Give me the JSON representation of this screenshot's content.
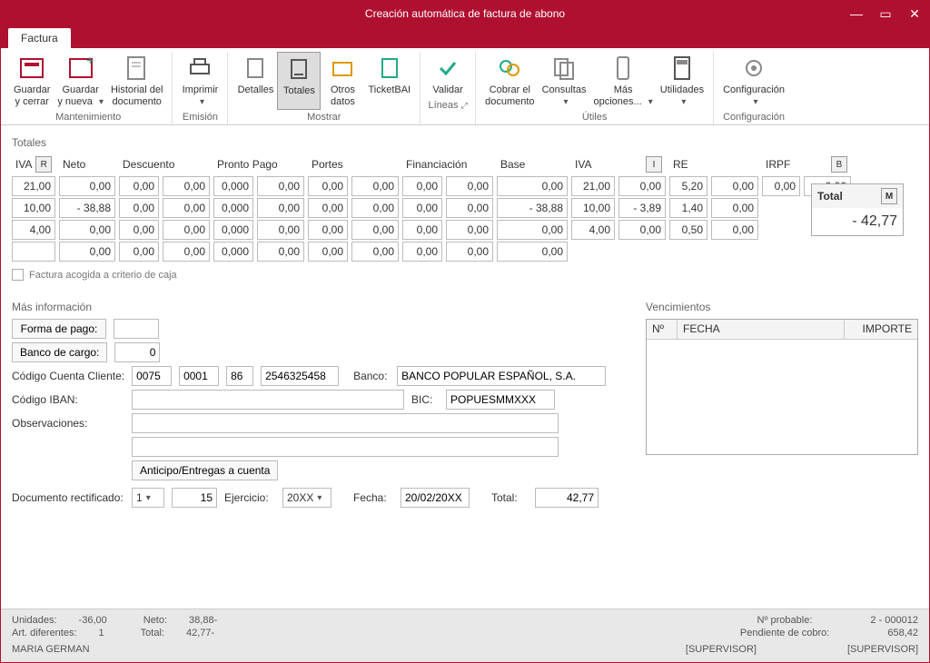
{
  "window": {
    "title": "Creación automática de factura de abono"
  },
  "tab": {
    "label": "Factura"
  },
  "ribbon": {
    "mantenimiento": {
      "label": "Mantenimiento",
      "guardar_cerrar": "Guardar\ny cerrar",
      "guardar_nueva": "Guardar\ny nueva",
      "historial": "Historial del\ndocumento"
    },
    "emision": {
      "label": "Emisión",
      "imprimir": "Imprimir"
    },
    "mostrar": {
      "label": "Mostrar",
      "detalles": "Detalles",
      "totales": "Totales",
      "otros": "Otros\ndatos",
      "ticketbai": "TicketBAI"
    },
    "lineas": {
      "label": "Líneas",
      "validar": "Validar"
    },
    "utiles": {
      "label": "Útiles",
      "cobrar": "Cobrar el\ndocumento",
      "consultas": "Consultas",
      "mas": "Más\nopciones...",
      "utilidades": "Utilidades"
    },
    "config": {
      "label": "Configuración",
      "configuracion": "Configuración"
    }
  },
  "totals": {
    "title": "Totales",
    "headers": {
      "iva": "IVA",
      "r": "R",
      "neto": "Neto",
      "descuento": "Descuento",
      "pronto": "Pronto Pago",
      "portes": "Portes",
      "financiacion": "Financiación",
      "base": "Base",
      "iva2": "IVA",
      "i": "I",
      "re": "RE",
      "irpf": "IRPF",
      "b": "B"
    },
    "rows": [
      {
        "iva_r": "21,00",
        "neto": "0,00",
        "desc_p": "0,00",
        "desc_a": "0,00",
        "pp_p": "0,000",
        "pp_a": "0,00",
        "por_p": "0,00",
        "por_a": "0,00",
        "fin_p": "0,00",
        "fin_a": "0,00",
        "base": "0,00",
        "ivapct": "21,00",
        "ivaamt": "0,00",
        "re_p": "5,20",
        "re_a": "0,00",
        "irpf_p": "0,00",
        "irpf_a": "0,00"
      },
      {
        "iva_r": "10,00",
        "neto": "-         38,88",
        "desc_p": "0,00",
        "desc_a": "0,00",
        "pp_p": "0,000",
        "pp_a": "0,00",
        "por_p": "0,00",
        "por_a": "0,00",
        "fin_p": "0,00",
        "fin_a": "0,00",
        "base": "-         38,88",
        "ivapct": "10,00",
        "ivaamt": "-          3,89",
        "re_p": "1,40",
        "re_a": "0,00",
        "irpf_p": "",
        "irpf_a": ""
      },
      {
        "iva_r": "4,00",
        "neto": "0,00",
        "desc_p": "0,00",
        "desc_a": "0,00",
        "pp_p": "0,000",
        "pp_a": "0,00",
        "por_p": "0,00",
        "por_a": "0,00",
        "fin_p": "0,00",
        "fin_a": "0,00",
        "base": "0,00",
        "ivapct": "4,00",
        "ivaamt": "0,00",
        "re_p": "0,50",
        "re_a": "0,00",
        "irpf_p": "",
        "irpf_a": ""
      },
      {
        "iva_r": "",
        "neto": "0,00",
        "desc_p": "0,00",
        "desc_a": "0,00",
        "pp_p": "0,000",
        "pp_a": "0,00",
        "por_p": "0,00",
        "por_a": "0,00",
        "fin_p": "0,00",
        "fin_a": "0,00",
        "base": "0,00",
        "ivapct": "",
        "ivaamt": "",
        "re_p": "",
        "re_a": "",
        "irpf_p": "",
        "irpf_a": ""
      }
    ],
    "total_label": "Total",
    "m": "M",
    "total_value": "-             42,77",
    "caja_checkbox": "Factura acogida a criterio de caja"
  },
  "more": {
    "title": "Más información",
    "forma_pago": "Forma de pago:",
    "forma_pago_val": "",
    "banco_cargo": "Banco de cargo:",
    "banco_cargo_val": "0",
    "ccc": "Código Cuenta Cliente:",
    "ccc1": "0075",
    "ccc2": "0001",
    "ccc3": "86",
    "ccc4": "2546325458",
    "banco_lbl": "Banco:",
    "banco_val": "BANCO POPULAR ESPAÑOL, S.A.",
    "iban_lbl": "Código IBAN:",
    "iban_val": "",
    "bic_lbl": "BIC:",
    "bic_val": "POPUESMMXXX",
    "obs_lbl": "Observaciones:",
    "anticipo_btn": "Anticipo/Entregas a cuenta",
    "doc_rect": "Documento rectificado:",
    "doc_rect_sel": "1",
    "doc_rect_num": "15",
    "ejercicio_lbl": "Ejercicio:",
    "ejercicio_val": "20XX",
    "fecha_lbl": "Fecha:",
    "fecha_val": "20/02/20XX",
    "total_lbl": "Total:",
    "total_val": "42,77"
  },
  "venc": {
    "title": "Vencimientos",
    "no": "Nº",
    "fecha": "FECHA",
    "importe": "IMPORTE"
  },
  "status": {
    "unidades_lbl": "Unidades:",
    "unidades_val": "-36,00",
    "neto_lbl": "Neto:",
    "neto_val": "38,88-",
    "art_lbl": "Art. diferentes:",
    "art_val": "1",
    "total_lbl": "Total:",
    "total_val": "42,77-",
    "probable_lbl": "Nº probable:",
    "probable_val": "2 - 000012",
    "pendiente_lbl": "Pendiente de cobro:",
    "pendiente_val": "658,42",
    "user": "MARIA GERMAN",
    "sup": "[SUPERVISOR]"
  }
}
